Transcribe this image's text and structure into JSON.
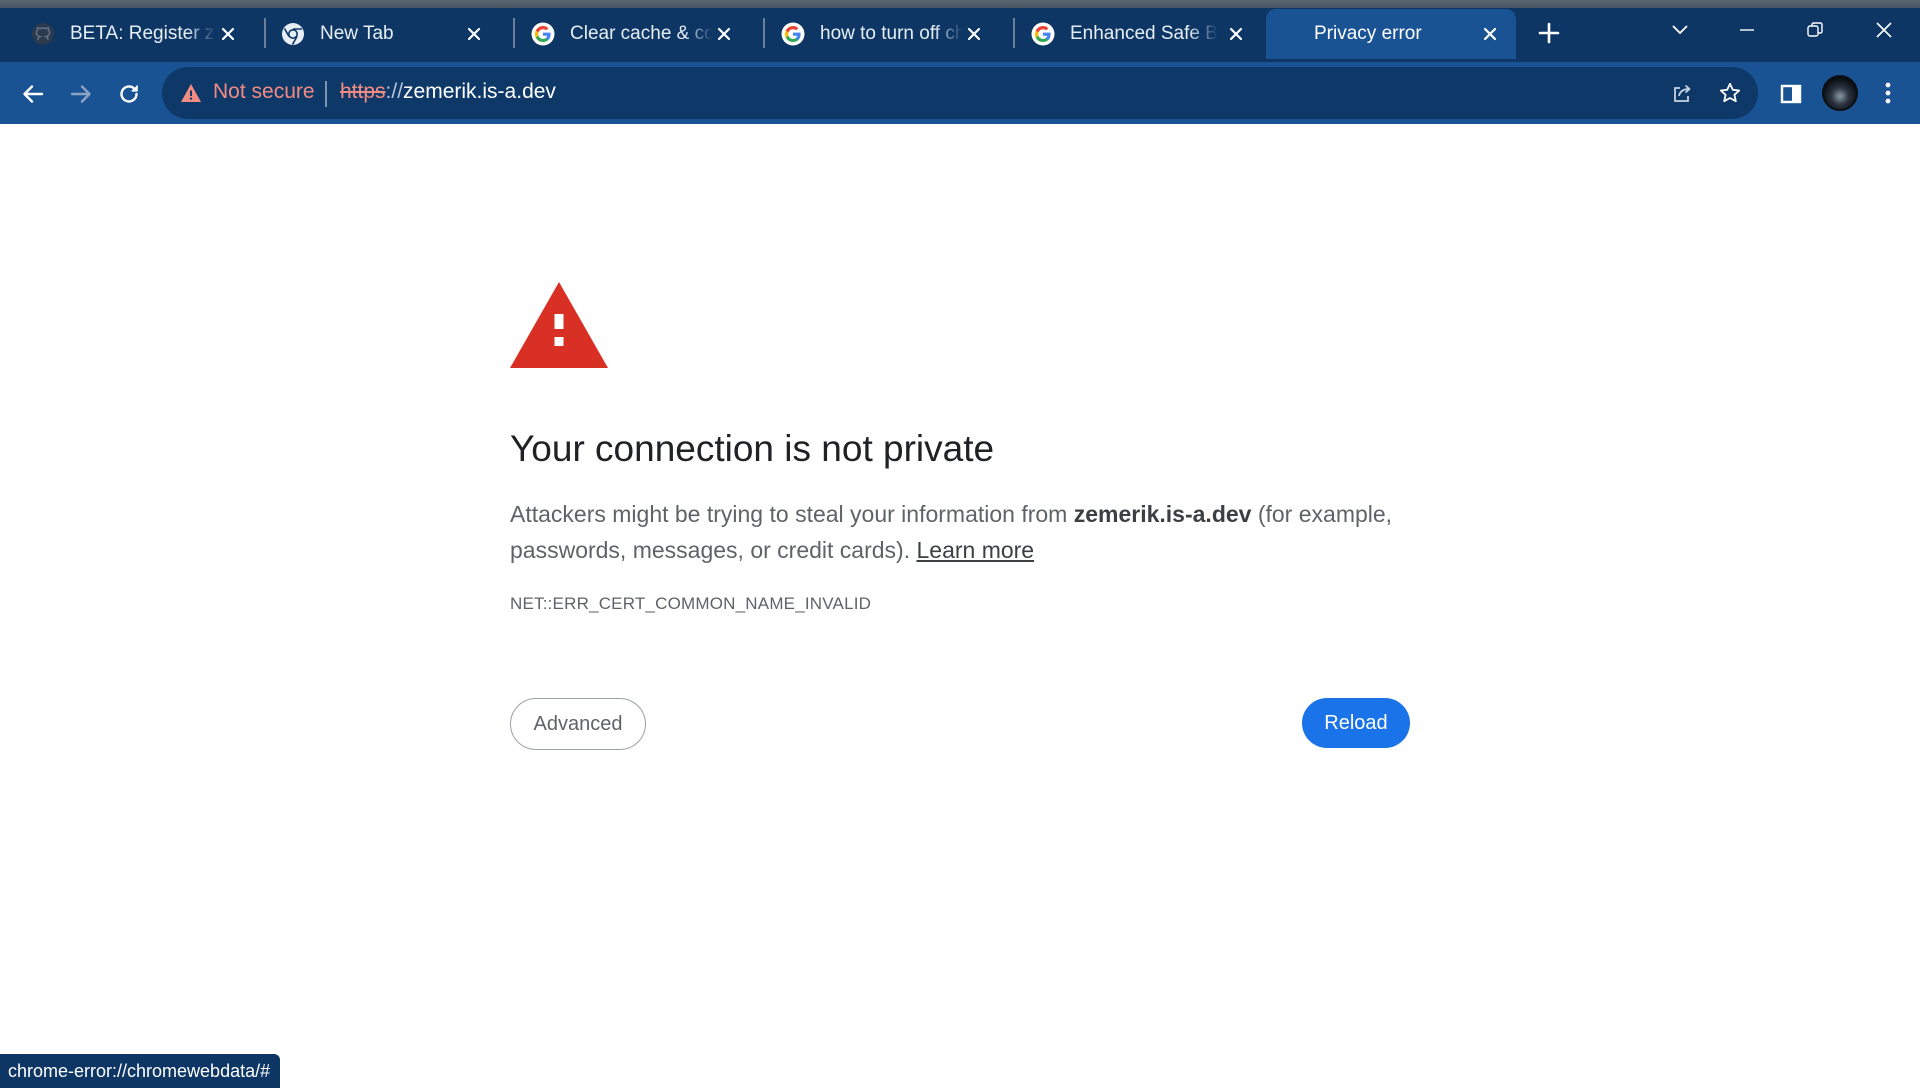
{
  "tabs": [
    {
      "title": "BETA: Register zemerik",
      "favicon": "github-icon",
      "active": false
    },
    {
      "title": "New Tab",
      "favicon": "chrome-icon",
      "active": false
    },
    {
      "title": "Clear cache & cookies",
      "favicon": "google-icon",
      "active": false
    },
    {
      "title": "how to turn off chrome",
      "favicon": "google-icon",
      "active": false
    },
    {
      "title": "Enhanced Safe Browsing",
      "favicon": "google-icon",
      "active": false
    },
    {
      "title": "Privacy error",
      "favicon": "",
      "active": true
    }
  ],
  "toolbar": {
    "security_label": "Not secure",
    "url_scheme": "https",
    "url_separator": "://",
    "url_host": "zemerik.is-a.dev"
  },
  "page": {
    "heading": "Your connection is not private",
    "explanation_before": "Attackers might be trying to steal your information from ",
    "explanation_host": "zemerik.is-a.dev",
    "explanation_after": " (for example, passwords, messages, or credit cards). ",
    "learn_more": "Learn more",
    "error_code": "NET::ERR_CERT_COMMON_NAME_INVALID",
    "advanced_label": "Advanced",
    "reload_label": "Reload"
  },
  "status_bar": {
    "text": "chrome-error://chromewebdata/#"
  },
  "colors": {
    "frame": "#0d3664",
    "toolbar": "#1a5394",
    "omnibox": "#0e3868",
    "warning_red": "#d93025",
    "insecure_text": "#f28b82",
    "primary_button": "#1a73e8"
  }
}
